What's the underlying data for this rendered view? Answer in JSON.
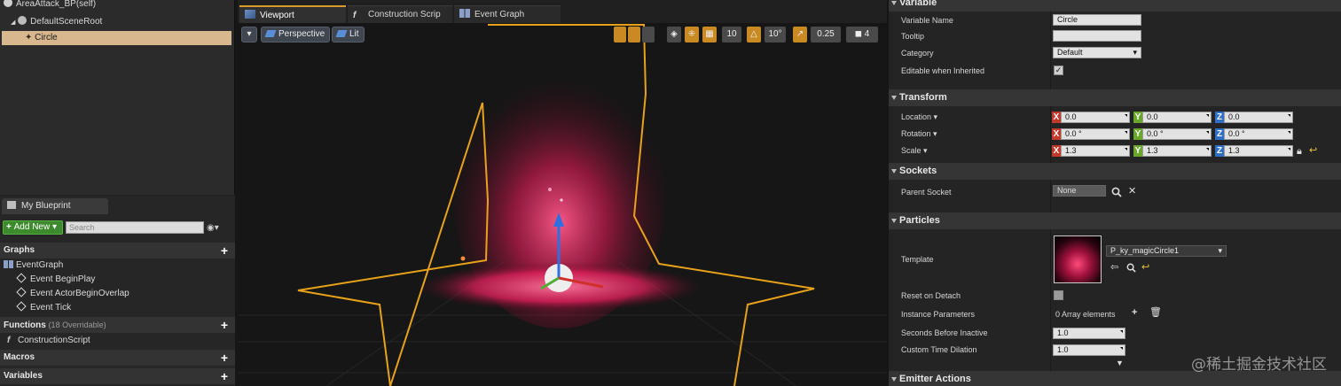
{
  "component_tree": {
    "root_label": "AreaAttack_BP(self)",
    "scene_root": "DefaultSceneRoot",
    "selected": "Circle"
  },
  "my_blueprint": {
    "tab_label": "My Blueprint",
    "add_new_label": "Add New",
    "search_placeholder": "Search",
    "graphs": {
      "header": "Graphs",
      "event_graph": "EventGraph",
      "events": [
        "Event BeginPlay",
        "Event ActorBeginOverlap",
        "Event Tick"
      ]
    },
    "functions": {
      "header": "Functions",
      "overridable": "(18 Overridable)",
      "items": [
        "ConstructionScript"
      ]
    },
    "macros_header": "Macros",
    "variables_header": "Variables"
  },
  "editor_tabs": [
    "Viewport",
    "Construction Scrip",
    "Event Graph"
  ],
  "viewport_toolbar": {
    "perspective_label": "Perspective",
    "lit_label": "Lit",
    "grid_snap": "10",
    "rotation_snap": "10°",
    "scale_snap": "0.25",
    "camera_speed": "4"
  },
  "details": {
    "variable": {
      "header": "Variable",
      "name_label": "Variable Name",
      "name_value": "Circle",
      "tooltip_label": "Tooltip",
      "tooltip_value": "",
      "category_label": "Category",
      "category_value": "Default",
      "editable_label": "Editable when Inherited",
      "editable_checked": true
    },
    "transform": {
      "header": "Transform",
      "location_label": "Location",
      "rotation_label": "Rotation",
      "scale_label": "Scale",
      "location": [
        "0.0",
        "0.0",
        "0.0"
      ],
      "rotation": [
        "0.0 °",
        "0.0 °",
        "0.0 °"
      ],
      "scale": [
        "1.3",
        "1.3",
        "1.3"
      ],
      "axis_labels": [
        "X",
        "Y",
        "Z"
      ]
    },
    "sockets": {
      "header": "Sockets",
      "parent_label": "Parent Socket",
      "parent_value": "None"
    },
    "particles": {
      "header": "Particles",
      "template_label": "Template",
      "template_value": "P_ky_magicCircle1",
      "reset_label": "Reset on Detach",
      "instance_label": "Instance Parameters",
      "instance_value": "0 Array elements",
      "seconds_label": "Seconds Before Inactive",
      "seconds_value": "1.0",
      "dilation_label": "Custom Time Dilation",
      "dilation_value": "1.0"
    },
    "emitter_header": "Emitter Actions"
  },
  "watermark": "@稀土掘金技术社区",
  "colors": {
    "selection": "#d8b78e",
    "accent_orange": "#d89b2c",
    "add_new_green": "#3c8a2c",
    "axis_x": "#c0392b",
    "axis_y": "#6aa82b",
    "axis_z": "#2f6fc7"
  }
}
